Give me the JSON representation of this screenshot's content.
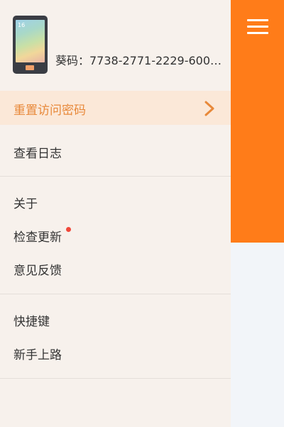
{
  "device": {
    "code_label": "葵码：7738-2771-2229-6000-...",
    "phone_clock": "16"
  },
  "menu": {
    "reset_password": "重置访问密码",
    "view_log": "查看日志",
    "about": "关于",
    "check_update": "检查更新",
    "feedback": "意见反馈",
    "shortcuts": "快捷键",
    "beginner_guide": "新手上路"
  },
  "colors": {
    "accent": "#ff7c19",
    "active_text": "#e8893a",
    "active_bg": "#fbe8d8",
    "badge": "#f0483a"
  },
  "icons": {
    "menu": "hamburger-menu-icon",
    "device": "phone-icon",
    "arrow": "chevron-right-icon",
    "update_badge": "notification-dot-icon"
  }
}
